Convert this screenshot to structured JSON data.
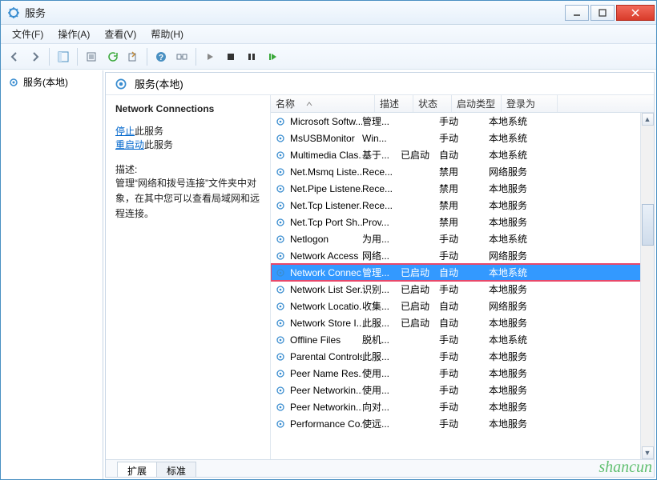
{
  "window": {
    "title": "服务"
  },
  "menu": {
    "file": "文件(F)",
    "action": "操作(A)",
    "view": "查看(V)",
    "help": "帮助(H)"
  },
  "tree": {
    "root": "服务(本地)"
  },
  "panelHeader": "服务(本地)",
  "detail": {
    "serviceName": "Network Connections",
    "stop": "停止",
    "stopSuffix": "此服务",
    "restart": "重启动",
    "restartSuffix": "此服务",
    "descLabel": "描述:",
    "descText": "管理“网络和拨号连接”文件夹中对象，在其中您可以查看局域网和远程连接。"
  },
  "columns": {
    "name": "名称",
    "desc": "描述",
    "status": "状态",
    "startup": "启动类型",
    "logon": "登录为"
  },
  "services": [
    {
      "name": "Microsoft Softw...",
      "desc": "管理...",
      "status": "",
      "startup": "手动",
      "logon": "本地系统"
    },
    {
      "name": "MsUSBMonitor",
      "desc": "Win...",
      "status": "",
      "startup": "手动",
      "logon": "本地系统"
    },
    {
      "name": "Multimedia Clas...",
      "desc": "基于...",
      "status": "已启动",
      "startup": "自动",
      "logon": "本地系统"
    },
    {
      "name": "Net.Msmq Liste...",
      "desc": "Rece...",
      "status": "",
      "startup": "禁用",
      "logon": "网络服务"
    },
    {
      "name": "Net.Pipe Listene...",
      "desc": "Rece...",
      "status": "",
      "startup": "禁用",
      "logon": "本地服务"
    },
    {
      "name": "Net.Tcp Listener...",
      "desc": "Rece...",
      "status": "",
      "startup": "禁用",
      "logon": "本地服务"
    },
    {
      "name": "Net.Tcp Port Sh...",
      "desc": "Prov...",
      "status": "",
      "startup": "禁用",
      "logon": "本地服务"
    },
    {
      "name": "Netlogon",
      "desc": "为用...",
      "status": "",
      "startup": "手动",
      "logon": "本地系统"
    },
    {
      "name": "Network Access ...",
      "desc": "网络...",
      "status": "",
      "startup": "手动",
      "logon": "网络服务"
    },
    {
      "name": "Network Connec...",
      "desc": "管理...",
      "status": "已启动",
      "startup": "自动",
      "logon": "本地系统",
      "selected": true
    },
    {
      "name": "Network List Ser...",
      "desc": "识别...",
      "status": "已启动",
      "startup": "手动",
      "logon": "本地服务"
    },
    {
      "name": "Network Locatio...",
      "desc": "收集...",
      "status": "已启动",
      "startup": "自动",
      "logon": "网络服务"
    },
    {
      "name": "Network Store I...",
      "desc": "此服...",
      "status": "已启动",
      "startup": "自动",
      "logon": "本地服务"
    },
    {
      "name": "Offline Files",
      "desc": "脱机...",
      "status": "",
      "startup": "手动",
      "logon": "本地系统"
    },
    {
      "name": "Parental Controls",
      "desc": "此服...",
      "status": "",
      "startup": "手动",
      "logon": "本地服务"
    },
    {
      "name": "Peer Name Res...",
      "desc": "使用...",
      "status": "",
      "startup": "手动",
      "logon": "本地服务"
    },
    {
      "name": "Peer Networkin...",
      "desc": "使用...",
      "status": "",
      "startup": "手动",
      "logon": "本地服务"
    },
    {
      "name": "Peer Networkin...",
      "desc": "向对...",
      "status": "",
      "startup": "手动",
      "logon": "本地服务"
    },
    {
      "name": "Performance Co...",
      "desc": "使远...",
      "status": "",
      "startup": "手动",
      "logon": "本地服务"
    }
  ],
  "tabs": {
    "extended": "扩展",
    "standard": "标准"
  },
  "watermark": "shancun"
}
